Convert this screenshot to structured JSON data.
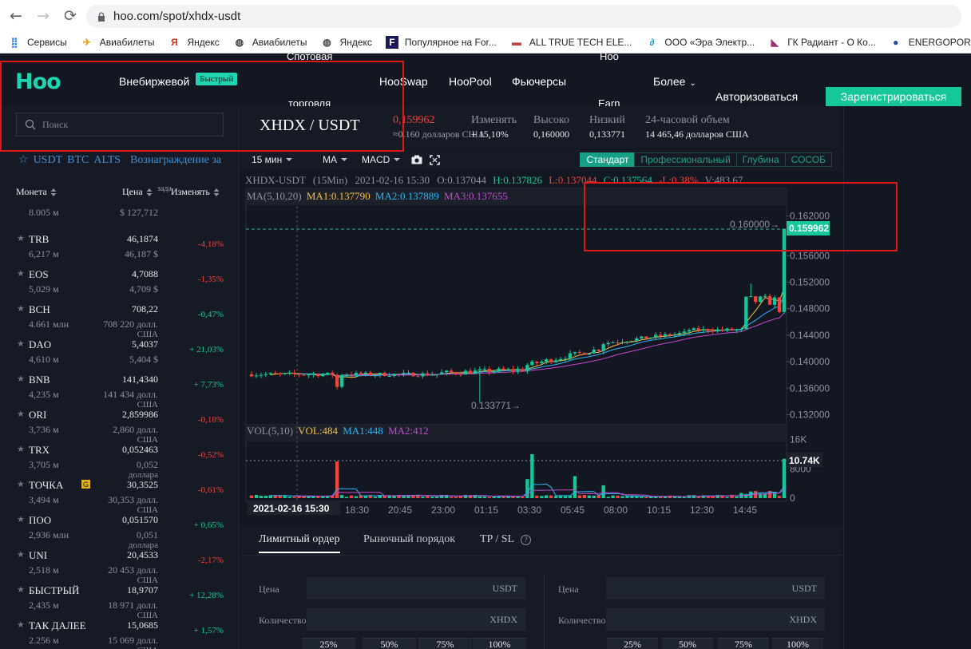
{
  "browser": {
    "url": "hoo.com/spot/xhdx-usdt",
    "bookmarks": [
      {
        "label": "Сервисы",
        "icon": "apps-grid-icon"
      },
      {
        "label": "Авиабилеты",
        "icon": "plane-icon"
      },
      {
        "label": "Яндекс",
        "icon": "yandex-icon"
      },
      {
        "label": "Авиабилеты",
        "icon": "globe-icon"
      },
      {
        "label": "Яндекс",
        "icon": "globe-icon"
      },
      {
        "label": "Популярное на For...",
        "icon": "forbes-icon"
      },
      {
        "label": "ALL TRUE TECH ELE...",
        "icon": "att-icon"
      },
      {
        "label": "ООО «Эра Электр...",
        "icon": "era-icon"
      },
      {
        "label": "ГК Радиант - О Ко...",
        "icon": "radiant-icon"
      },
      {
        "label": "ENERGOPORTAL.R",
        "icon": "energoportal-icon"
      }
    ]
  },
  "header": {
    "logo": "Hoo",
    "otc": "Внебиржевой",
    "fast_badge": "Быстрый",
    "spot_top": "Спотовая",
    "spot_bottom": "торговля",
    "hooswap": "HooSwap",
    "hoopool": "HooPool",
    "futures": "Фьючерсы",
    "hoo_earn_top": "Hoo",
    "hoo_earn_bottom": "Earn",
    "more": "Более",
    "login": "Авторизоваться",
    "register": "Зарегистрироваться"
  },
  "left": {
    "search_placeholder": "Поиск",
    "market_tabs": [
      "USDT",
      "BTC",
      "ALTS",
      "Вознаграждение за"
    ],
    "col_coin": "Монета",
    "col_price": "Цена",
    "col_change": "Изменять",
    "col_tiny": "зада",
    "first_row": {
      "vol": "8.005 м",
      "usd": "$ 127,712"
    },
    "coins": [
      {
        "name": "TRB",
        "vol": "6,217 м",
        "price": "46,1874",
        "usd": "46,187 $",
        "sub": "",
        "change": "-4,18%",
        "dir": "neg",
        "g": false
      },
      {
        "name": "EOS",
        "vol": "5,029 м",
        "price": "4,7088",
        "usd": "4,709 $",
        "sub": "",
        "change": "-1,35%",
        "dir": "neg",
        "g": false
      },
      {
        "name": "BCH",
        "vol": "4.661 млн",
        "price": "708,22",
        "usd": "708 220 долл.",
        "sub": "США",
        "change": "-0,47%",
        "dir": "pos",
        "g": false
      },
      {
        "name": "DAO",
        "vol": "4,610 м",
        "price": "5,4037",
        "usd": "5,404 $",
        "sub": "",
        "change": "+ 21,03%",
        "dir": "pos",
        "g": false
      },
      {
        "name": "BNB",
        "vol": "4,235 м",
        "price": "141,4340",
        "usd": "141 434 долл.",
        "sub": "США",
        "change": "+ 7,73%",
        "dir": "pos",
        "g": false
      },
      {
        "name": "ORI",
        "vol": "3,736 м",
        "price": "2,859986",
        "usd": "2,860 долл.",
        "sub": "США",
        "change": "-0,18%",
        "dir": "neg",
        "g": false
      },
      {
        "name": "TRX",
        "vol": "3,705 м",
        "price": "0,052463",
        "usd": "0,052",
        "sub": "доллара",
        "change": "-0,52%",
        "dir": "neg",
        "g": false
      },
      {
        "name": "ТОЧКА",
        "vol": "3,494 м",
        "price": "30,3525",
        "usd": "30,353 долл.",
        "sub": "США",
        "change": "-0,61%",
        "dir": "neg",
        "g": true
      },
      {
        "name": "ПОО",
        "vol": "2,936 млн",
        "price": "0,051570",
        "usd": "0,051",
        "sub": "доллара",
        "change": "+ 0,65%",
        "dir": "pos",
        "g": false
      },
      {
        "name": "UNI",
        "vol": "2,518 м",
        "price": "20,4533",
        "usd": "20 453 долл.",
        "sub": "США",
        "change": "-2,17%",
        "dir": "neg",
        "g": false
      },
      {
        "name": "БЫСТРЫЙ",
        "vol": "2,435 м",
        "price": "18,9707",
        "usd": "18 971 долл.",
        "sub": "США",
        "change": "+ 12,28%",
        "dir": "pos",
        "g": false
      },
      {
        "name": "ТАК ДАЛЕЕ",
        "vol": "2.256 м",
        "price": "15,0685",
        "usd": "15 069 долл.",
        "sub": "США",
        "change": "+ 1,57%",
        "dir": "pos",
        "g": false
      }
    ]
  },
  "ticker": {
    "pair": "XHDX / USDT",
    "last": "0,159962",
    "last_usd": "≈0.160 долларов США",
    "change_label": "Изменять",
    "change_value": "+ 15,10%",
    "high_label": "Высоко",
    "high_value": "0,160000",
    "low_label": "Низкий",
    "low_value": "0,133771",
    "vol_label": "24-часовой объем",
    "vol_value": "14 465,46 долларов США"
  },
  "toolbar": {
    "interval": "15 мин",
    "ma": "MA",
    "macd": "MACD",
    "modes": [
      "Стандарт",
      "Профессиональный",
      "Глубина",
      "СОСОБ"
    ]
  },
  "chart_info": {
    "ohlc_pair": "XHDX-USDT",
    "ohlc_interval": "(15Min)",
    "ohlc_time": "2021-02-16  15:30",
    "ohlc_o": "O:0.137044",
    "ohlc_h": "H:0.137826",
    "ohlc_l": "L:0.137044",
    "ohlc_c": "C:0.137564",
    "ohlc_chg": "-L:0.38%",
    "ohlc_v": "V:483.67",
    "ma_label": "MA(5,10,20)",
    "ma1": "MA1:0.137790",
    "ma2": "MA2:0.137889",
    "ma3": "MA3:0.137655",
    "high_marker": "0.160000→",
    "low_marker": "0.133771→",
    "last_tag": "0.159962",
    "vol_label": "VOL(5,10)",
    "vol": "VOL:484",
    "vol_ma1": "MA1:448",
    "vol_ma2": "MA2:412",
    "vol_tag": "10.74K",
    "cursor_time": "2021-02-16  15:30"
  },
  "chart_data": {
    "type": "candlestick",
    "price_axis": [
      "0.162000",
      "0.160000",
      "0.156000",
      "0.152000",
      "0.148000",
      "0.144000",
      "0.140000",
      "0.136000",
      "0.132000"
    ],
    "price_range": [
      0.1305,
      0.1635
    ],
    "volume_axis": [
      "16K",
      "8000",
      "0"
    ],
    "volume_range": [
      0,
      17000
    ],
    "time_axis": [
      "18:30",
      "20:45",
      "23:00",
      "01:15",
      "03:30",
      "05:45",
      "08:00",
      "10:15",
      "12:30",
      "14:45"
    ],
    "last_price": 0.159962,
    "high": 0.16,
    "low": 0.133771,
    "colors": {
      "up": "#16c79a",
      "down": "#f0443c",
      "ma1": "#f6c244",
      "ma2": "#29b6f6",
      "ma3": "#c34acb"
    }
  },
  "order": {
    "tabs": [
      "Лимитный ордер",
      "Рыночный порядок",
      "TP / SL"
    ],
    "price_label": "Цена",
    "qty_label": "Количество",
    "price_unit": "USDT",
    "qty_unit": "XHDX",
    "pcts": [
      "25%",
      "50%",
      "75%",
      "100%"
    ]
  }
}
